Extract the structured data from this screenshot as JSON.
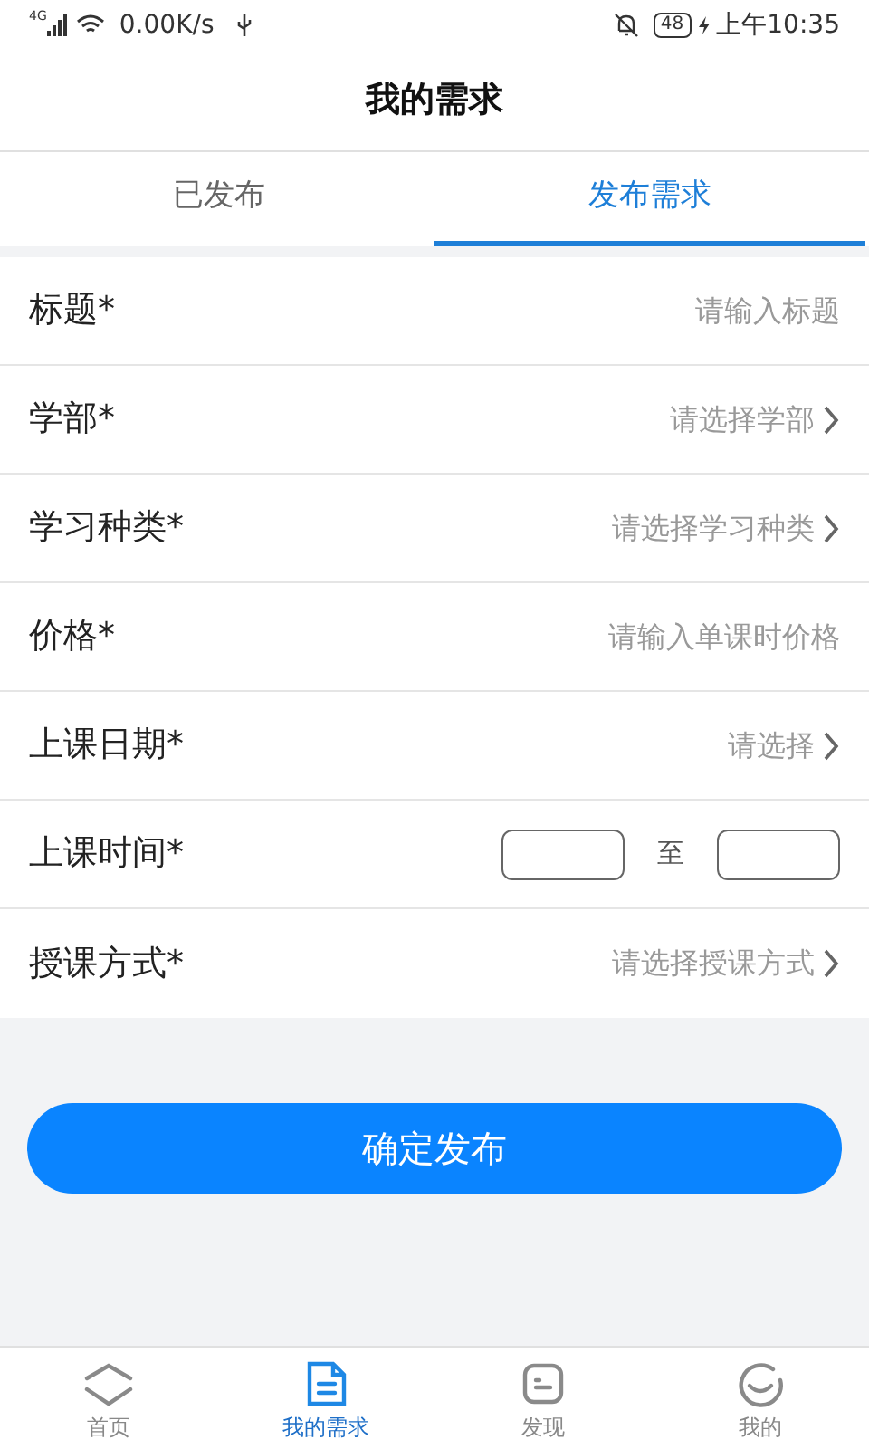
{
  "status_bar": {
    "network": "4G",
    "speed": "0.00K/s",
    "battery": "48",
    "time": "上午10:35"
  },
  "title": "我的需求",
  "tabs": [
    {
      "label": "已发布",
      "selected": false
    },
    {
      "label": "发布需求",
      "selected": true
    }
  ],
  "form": [
    {
      "kind": "input",
      "label": "标题*",
      "placeholder": "请输入标题"
    },
    {
      "kind": "select",
      "label": "学部*",
      "placeholder": "请选择学部"
    },
    {
      "kind": "select",
      "label": "学习种类*",
      "placeholder": "请选择学习种类"
    },
    {
      "kind": "input",
      "label": "价格*",
      "placeholder": "请输入单课时价格"
    },
    {
      "kind": "select",
      "label": "上课日期*",
      "placeholder": "请选择"
    },
    {
      "kind": "time_range",
      "label": "上课时间*",
      "separator": "至"
    },
    {
      "kind": "select",
      "label": "授课方式*",
      "placeholder": "请选择授课方式"
    }
  ],
  "submit": "确定发布",
  "nav": [
    {
      "label": "首页",
      "selected": false
    },
    {
      "label": "我的需求",
      "selected": true
    },
    {
      "label": "发现",
      "selected": false
    },
    {
      "label": "我的",
      "selected": false
    }
  ]
}
